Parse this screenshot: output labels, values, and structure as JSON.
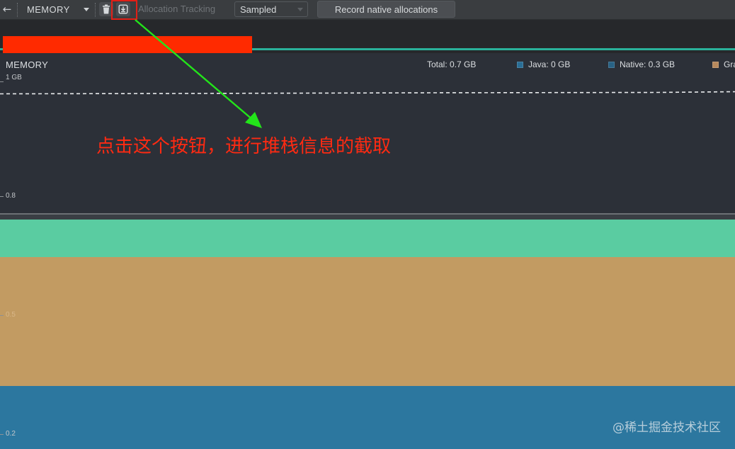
{
  "toolbar": {
    "back_glyph": "←",
    "profiler_name": "MEMORY",
    "allocation_tracking_label": "Allocation Tracking",
    "sampling_mode": "Sampled",
    "record_native_label": "Record native allocations",
    "icons": {
      "back": "back-arrow-icon",
      "dropdown": "chevron-down-icon",
      "trash": "trash-icon",
      "capture": "capture-heap-dump-icon"
    }
  },
  "chart": {
    "title": "MEMORY",
    "total_label": "Total: 0.7 GB",
    "legend": [
      {
        "label": "Java: 0 GB",
        "color": "#2a6e96"
      },
      {
        "label": "Native: 0.3 GB",
        "color": "#286285"
      },
      {
        "label": "Gra",
        "color": "#b7895d"
      }
    ],
    "axis_labels": {
      "top": "1 GB",
      "upper": "0.8",
      "middle": "0.5",
      "bottom": "0.2"
    },
    "bands": [
      {
        "name": "green-band",
        "color": "#5acca1"
      },
      {
        "name": "tan-band",
        "color": "#c29b62"
      },
      {
        "name": "blue-band",
        "color": "#2c779f"
      }
    ]
  },
  "annotation": {
    "text": "点击这个按钮，进行堆栈信息的截取",
    "color": "#ff2a12",
    "arrow_color": "#23e51a"
  },
  "watermark": "@稀土掘金技术社区"
}
